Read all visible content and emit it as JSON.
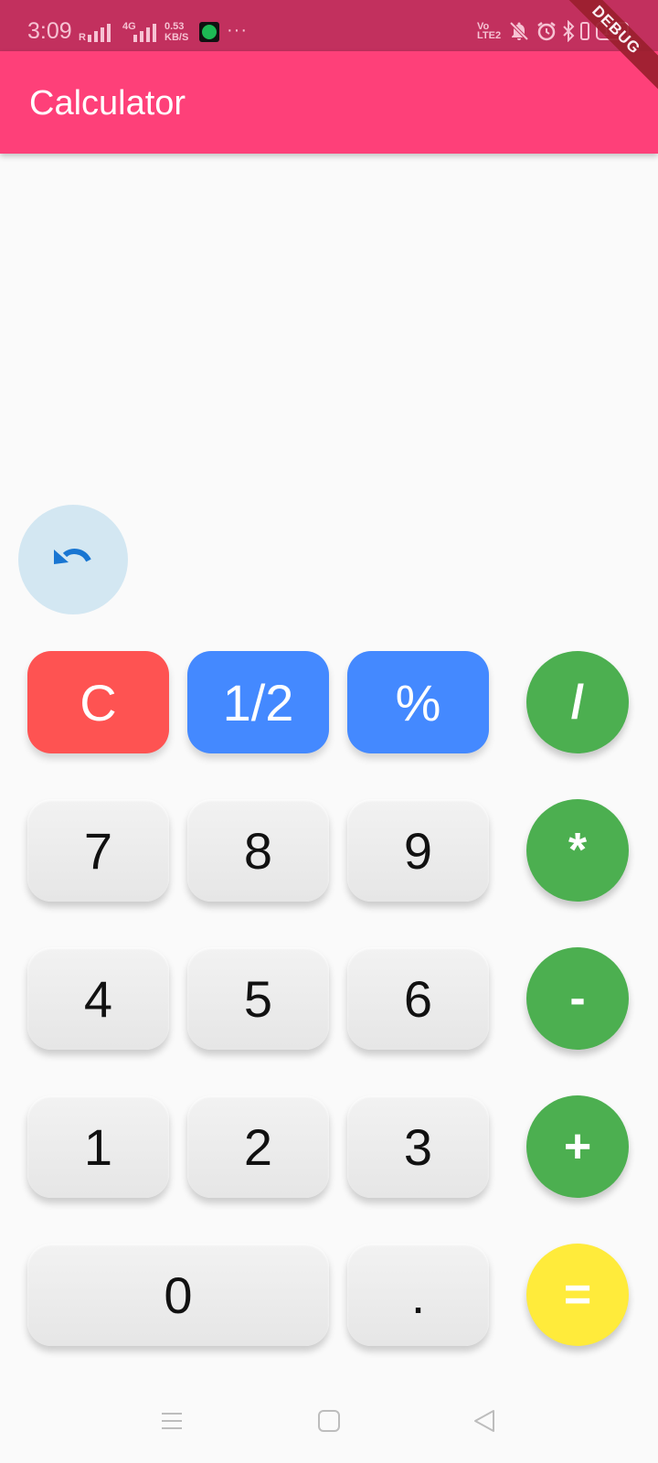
{
  "status_bar": {
    "time": "3:09",
    "roaming": "R",
    "network": "4G",
    "speed_value": "0.53",
    "speed_unit": "KB/S",
    "more": "···",
    "volte": "Vo LTE2",
    "battery": "100",
    "icons": [
      "signal-icon",
      "spotify-icon",
      "mute-icon",
      "alarm-icon",
      "bluetooth-icon",
      "vibrate-icon",
      "battery-icon"
    ]
  },
  "debug_banner": "DEBUG",
  "app_bar": {
    "title": "Calculator"
  },
  "display": {
    "expression": "",
    "result": ""
  },
  "undo": {
    "icon": "undo-icon",
    "color": "#1976d2"
  },
  "keys": {
    "clear": "C",
    "half": "1/2",
    "percent": "%",
    "divide": "/",
    "seven": "7",
    "eight": "8",
    "nine": "9",
    "multiply": "*",
    "four": "4",
    "five": "5",
    "six": "6",
    "minus": "-",
    "one": "1",
    "two": "2",
    "three": "3",
    "plus": "+",
    "zero": "0",
    "dot": ".",
    "equals": "="
  },
  "colors": {
    "status_bar": "#c2305e",
    "app_bar": "#fe4079",
    "clear_key": "#fe5352",
    "function_key": "#4489ff",
    "operator_key": "#4caf50",
    "equals_key": "#ffeb3b",
    "number_key": "#eeeeee"
  }
}
